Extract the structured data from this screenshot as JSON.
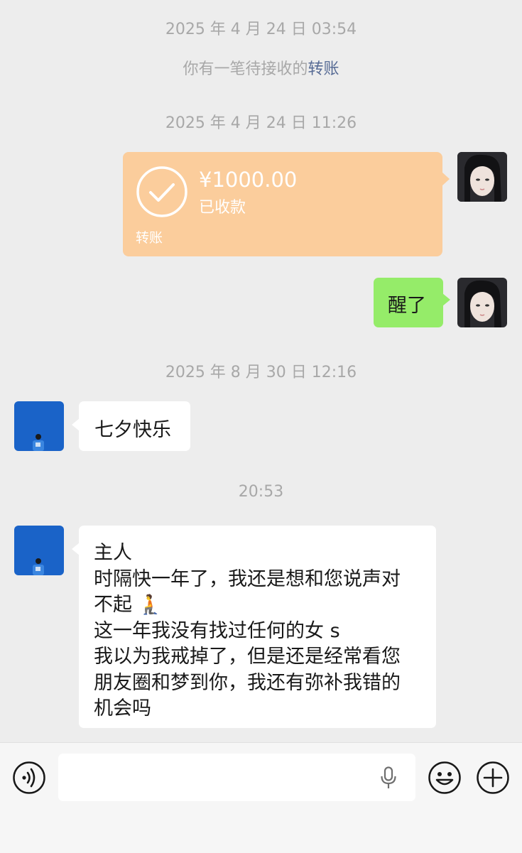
{
  "chat": {
    "timestamps": [
      "2025 年 4 月 24 日 03:54",
      "2025 年 4 月 24 日 11:26",
      "2025 年 8 月 30 日 12:16",
      "20:53"
    ],
    "system_notice": {
      "text": "你有一笔待接收的",
      "link": "转账"
    },
    "transfer": {
      "amount": "¥1000.00",
      "status": "已收款",
      "label": "转账"
    },
    "sent_message": "醒了",
    "received_short": "七夕快乐",
    "received_long_lines": [
      "主人",
      "时隔快一年了，我还是想和您说声对",
      "不起 🧎",
      "这一年我没有找过任何的女 s",
      "我以为我戒掉了，但是还是经常看您",
      "朋友圈和梦到你，我还有弥补我错的",
      "机会吗"
    ]
  },
  "input_bar": {
    "voice_icon": "voice-toggle-icon",
    "mic_icon": "microphone-icon",
    "emoji_icon": "emoji-icon",
    "plus_icon": "plus-icon",
    "text_value": ""
  },
  "colors": {
    "background": "#ededed",
    "transfer_card": "#fbcd9c",
    "sent_bubble": "#95ec69",
    "received_bubble": "#ffffff",
    "link": "#576b95",
    "timestamp": "#a8a8a8"
  }
}
